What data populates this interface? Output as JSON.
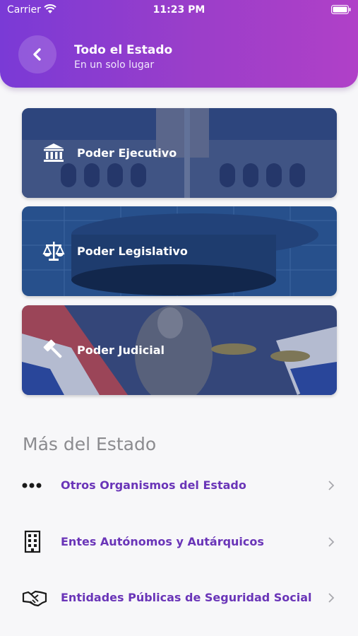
{
  "status_bar": {
    "carrier": "Carrier",
    "time": "11:23 PM"
  },
  "header": {
    "title": "Todo el Estado",
    "subtitle": "En un solo lugar"
  },
  "cards": [
    {
      "label": "Poder Ejecutivo",
      "icon": "building-columns-icon"
    },
    {
      "label": "Poder Legislativo",
      "icon": "scales-icon"
    },
    {
      "label": "Poder Judicial",
      "icon": "gavel-icon"
    }
  ],
  "more": {
    "title": "Más del Estado",
    "items": [
      {
        "label": "Otros Organismos del Estado",
        "icon": "ellipsis-icon"
      },
      {
        "label": "Entes Autónomos y Autárquicos",
        "icon": "building-icon"
      },
      {
        "label": "Entidades Públicas de Seguridad Social",
        "icon": "handshake-icon"
      }
    ]
  },
  "colors": {
    "header_start": "#7a3ad6",
    "header_end": "#b040c8",
    "link": "#6a35b8"
  }
}
